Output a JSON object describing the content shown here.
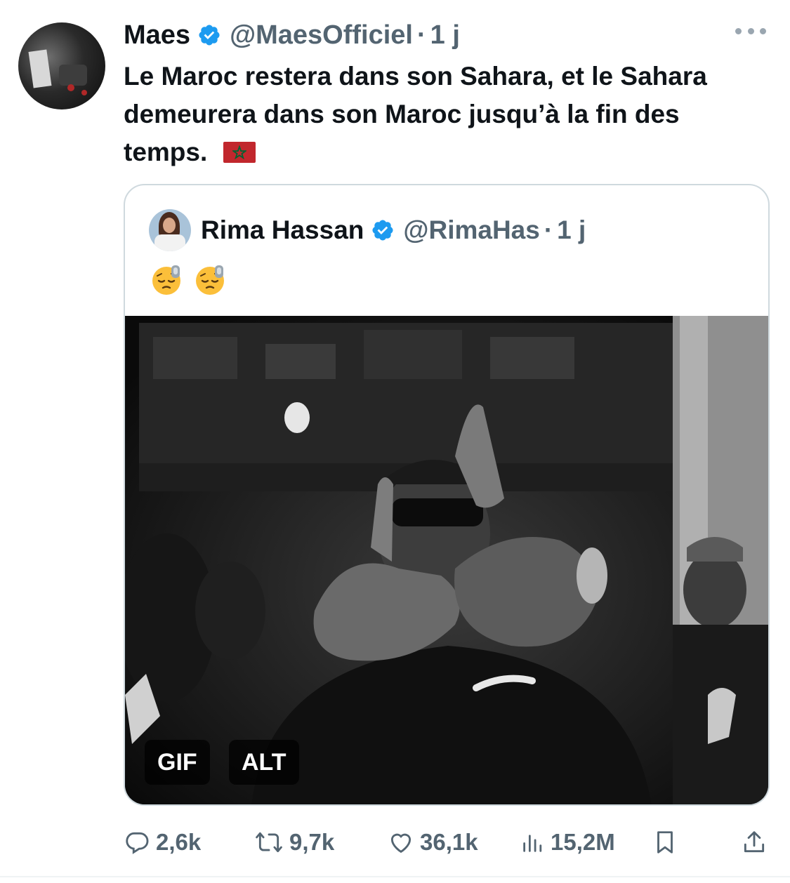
{
  "tweet": {
    "author_name": "Maes",
    "author_handle": "@MaesOfficiel",
    "separator": "·",
    "time": "1 j",
    "text": "Le Maroc restera dans son Sahara, et le Sahara demeurera dans son Maroc jusqu’à la fin des temps.",
    "flag_icon": "morocco-flag-emoji",
    "verified_color": "#1d9bf0"
  },
  "quoted": {
    "author_name": "Rima Hassan",
    "author_handle": "@RimaHas",
    "separator": "·",
    "time": "1 j",
    "emojis": [
      "pensive-face-emoji",
      "pensive-face-emoji"
    ],
    "media_badges": {
      "gif": "GIF",
      "alt": "ALT"
    }
  },
  "actions": {
    "replies": "2,6k",
    "reposts": "9,7k",
    "likes": "36,1k",
    "views": "15,2M"
  }
}
